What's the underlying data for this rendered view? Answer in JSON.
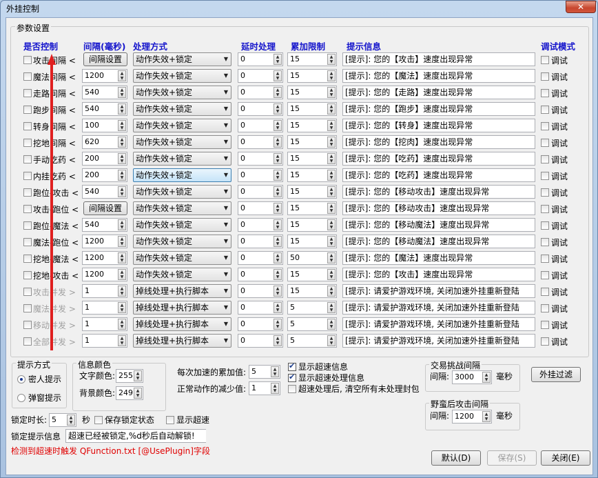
{
  "window": {
    "title": "外挂控制",
    "close_glyph": "✕"
  },
  "params": {
    "group_label": "参数设置"
  },
  "headers": {
    "control": "是否控制",
    "interval": "间隔(毫秒)",
    "method": "处理方式",
    "delay": "延时处理",
    "limit": "累加限制",
    "hint": "提示信息",
    "debug": "调试模式"
  },
  "rows": [
    {
      "label": "攻击间隔 <",
      "interval": "间隔设置",
      "interval_is_button": true,
      "method": "动作失效+锁定",
      "delay": "0",
      "limit": "15",
      "hint": "[提示]: 您的【攻击】速度出现异常",
      "debug": "调试",
      "disabled": false
    },
    {
      "label": "魔法间隔 <",
      "interval": "1200",
      "method": "动作失效+锁定",
      "delay": "0",
      "limit": "15",
      "hint": "[提示]: 您的【魔法】速度出现异常",
      "debug": "调试",
      "disabled": false
    },
    {
      "label": "走路间隔 <",
      "interval": "540",
      "method": "动作失效+锁定",
      "delay": "0",
      "limit": "15",
      "hint": "[提示]: 您的【走路】速度出现异常",
      "debug": "调试",
      "disabled": false
    },
    {
      "label": "跑步间隔 <",
      "interval": "540",
      "method": "动作失效+锁定",
      "delay": "0",
      "limit": "15",
      "hint": "[提示]: 您的【跑步】速度出现异常",
      "debug": "调试",
      "disabled": false
    },
    {
      "label": "转身间隔 <",
      "interval": "100",
      "method": "动作失效+锁定",
      "delay": "0",
      "limit": "15",
      "hint": "[提示]: 您的【转身】速度出现异常",
      "debug": "调试",
      "disabled": false
    },
    {
      "label": "挖地间隔 <",
      "interval": "620",
      "method": "动作失效+锁定",
      "delay": "0",
      "limit": "15",
      "hint": "[提示]: 您的【挖肉】速度出现异常",
      "debug": "调试",
      "disabled": false
    },
    {
      "label": "手动吃药 <",
      "interval": "200",
      "method": "动作失效+锁定",
      "delay": "0",
      "limit": "15",
      "hint": "[提示]: 您的【吃药】速度出现异常",
      "debug": "调试",
      "disabled": false
    },
    {
      "label": "内挂吃药 <",
      "interval": "200",
      "method": "动作失效+锁定",
      "method_highlight": true,
      "delay": "0",
      "limit": "15",
      "hint": "[提示]: 您的【吃药】速度出现异常",
      "debug": "调试",
      "disabled": false
    },
    {
      "label": "跑位-攻击 <",
      "interval": "540",
      "method": "动作失效+锁定",
      "delay": "0",
      "limit": "15",
      "hint": "[提示]: 您的【移动攻击】速度出现异常",
      "debug": "调试",
      "disabled": false
    },
    {
      "label": "攻击-跑位 <",
      "interval": "间隔设置",
      "interval_is_button": true,
      "method": "动作失效+锁定",
      "delay": "0",
      "limit": "15",
      "hint": "[提示]: 您的【移动攻击】速度出现异常",
      "debug": "调试",
      "disabled": false
    },
    {
      "label": "跑位-魔法 <",
      "interval": "540",
      "method": "动作失效+锁定",
      "delay": "0",
      "limit": "15",
      "hint": "[提示]: 您的【移动魔法】速度出现异常",
      "debug": "调试",
      "disabled": false
    },
    {
      "label": "魔法-跑位 <",
      "interval": "1200",
      "method": "动作失效+锁定",
      "delay": "0",
      "limit": "15",
      "hint": "[提示]: 您的【移动魔法】速度出现异常",
      "debug": "调试",
      "disabled": false
    },
    {
      "label": "挖地-魔法 <",
      "interval": "1200",
      "method": "动作失效+锁定",
      "delay": "0",
      "limit": "50",
      "hint": "[提示]: 您的【魔法】速度出现异常",
      "debug": "调试",
      "disabled": false
    },
    {
      "label": "挖地-攻击 <",
      "interval": "1200",
      "method": "动作失效+锁定",
      "delay": "0",
      "limit": "15",
      "hint": "[提示]: 您的【攻击】速度出现异常",
      "debug": "调试",
      "disabled": false
    },
    {
      "label": "攻击并发 >",
      "interval": "1",
      "method": "掉线处理+执行脚本",
      "delay": "0",
      "limit": "15",
      "hint": "[提示]: 请爱护游戏环境, 关闭加速外挂重新登陆",
      "debug": "调试",
      "disabled": true
    },
    {
      "label": "魔法并发 >",
      "interval": "1",
      "method": "掉线处理+执行脚本",
      "delay": "0",
      "limit": "5",
      "hint": "[提示]: 请爱护游戏环境, 关闭加速外挂重新登陆",
      "debug": "调试",
      "disabled": true
    },
    {
      "label": "移动并发 >",
      "interval": "1",
      "method": "掉线处理+执行脚本",
      "delay": "0",
      "limit": "5",
      "hint": "[提示]: 请爱护游戏环境, 关闭加速外挂重新登陆",
      "debug": "调试",
      "disabled": true
    },
    {
      "label": "全部并发 >",
      "interval": "1",
      "method": "掉线处理+执行脚本",
      "delay": "0",
      "limit": "5",
      "hint": "[提示]: 请爱护游戏环境, 关闭加速外挂重新登陆",
      "debug": "调试",
      "disabled": true
    }
  ],
  "prompt_mode": {
    "label": "提示方式",
    "option1": "密人提示",
    "option2": "弹窗提示",
    "selected": "密人提示"
  },
  "info_color": {
    "label": "信息颜色",
    "text_color_label": "文字颜色:",
    "text_color": "255",
    "bg_color_label": "背景颜色:",
    "bg_color": "249"
  },
  "accel": {
    "increment_label": "每次加速的累加值:",
    "increment": "5",
    "decrement_label": "正常动作的减少值:",
    "decrement": "1"
  },
  "options": {
    "show_speed_info": "显示超速信息",
    "show_speed_process": "显示超速处理信息",
    "clear_after": "超速处理后, 清空所有未处理封包",
    "show_speed_info_checked": true,
    "show_speed_process_checked": true,
    "clear_after_checked": false
  },
  "trade": {
    "label": "交易挑战间隔",
    "interval_label": "间隔:",
    "interval": "3000",
    "unit": "毫秒"
  },
  "savage": {
    "label": "野蛮后攻击间隔",
    "interval_label": "间隔:",
    "interval": "1200",
    "unit": "毫秒"
  },
  "filter_button": "外挂过滤",
  "lock": {
    "duration_label": "锁定时长:",
    "duration": "5",
    "unit": "秒",
    "save_state": "保存锁定状态",
    "show_speed": "显示超速",
    "info_label": "锁定提示信息",
    "info": "超速已经被锁定,%d秒后自动解锁!"
  },
  "red_notice": "检测到超速时触发 QFunction.txt [@UsePlugin]字段",
  "footer": {
    "default": "默认(D)",
    "save": "保存(S)",
    "close": "关闭(E)"
  },
  "colors": {
    "header_blue": "#1414cc",
    "red_arrow": "#e02020",
    "notice_red": "#e00000"
  }
}
